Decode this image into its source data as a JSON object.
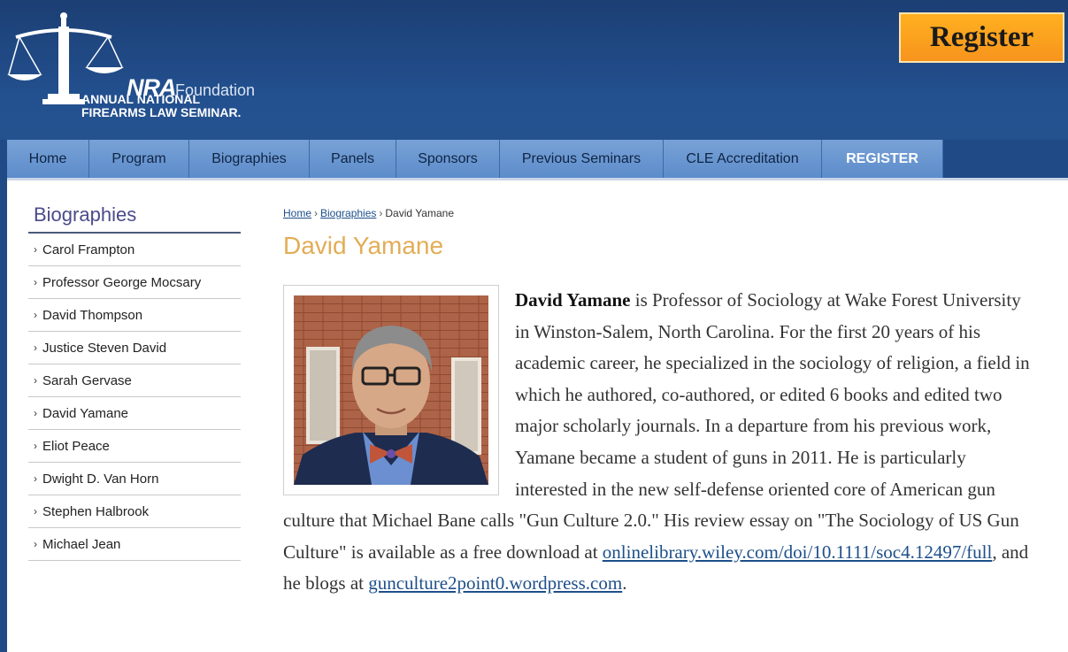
{
  "header": {
    "logo": {
      "org": "NRA",
      "foundation": "Foundation",
      "line1": "ANNUAL NATIONAL",
      "line2": "FIREARMS LAW SEMINAR."
    },
    "register_button": "Register"
  },
  "nav": {
    "items": [
      {
        "label": "Home"
      },
      {
        "label": "Program"
      },
      {
        "label": "Biographies"
      },
      {
        "label": "Panels"
      },
      {
        "label": "Sponsors"
      },
      {
        "label": "Previous Seminars"
      },
      {
        "label": "CLE Accreditation"
      },
      {
        "label": "REGISTER"
      }
    ]
  },
  "sidebar": {
    "title": "Biographies",
    "items": [
      {
        "label": "Carol Frampton"
      },
      {
        "label": "Professor George Mocsary"
      },
      {
        "label": "David Thompson"
      },
      {
        "label": "Justice Steven David"
      },
      {
        "label": "Sarah Gervase"
      },
      {
        "label": "David Yamane"
      },
      {
        "label": "Eliot Peace"
      },
      {
        "label": "Dwight D. Van Horn"
      },
      {
        "label": "Stephen Halbrook"
      },
      {
        "label": "Michael Jean"
      }
    ]
  },
  "breadcrumb": {
    "home": "Home",
    "section": "Biographies",
    "separator": "›",
    "current": "David Yamane"
  },
  "page": {
    "title": "David Yamane",
    "bio": {
      "name": "David Yamane",
      "text1": " is Professor of Sociology at Wake Forest University in Winston-Salem, North Carolina. For the first 20 years of his academic career, he specialized in the sociology of religion, a field in which he authored, co-authored, or edited 6 books and edited two major scholarly journals. In a departure from his previous work, Yamane became a student of guns in 2011. He is particularly interested in the new self-defense oriented core of American gun culture that Michael Bane calls \"Gun Culture 2.0.\" His review essay on \"The Sociology of US Gun Culture\" is available as a free download at ",
      "link1": "onlinelibrary.wiley.com/doi/10.1111/soc4.12497/full",
      "text2": ", and he blogs at ",
      "link2": "gunculture2point0.wordpress.com",
      "text3": "."
    }
  },
  "colors": {
    "header_bg": "#23508f",
    "register_orange": "#f7941d",
    "nav_blue": "#6a97d0",
    "title_gold": "#e2ad57",
    "link_blue": "#1d4f8a"
  }
}
